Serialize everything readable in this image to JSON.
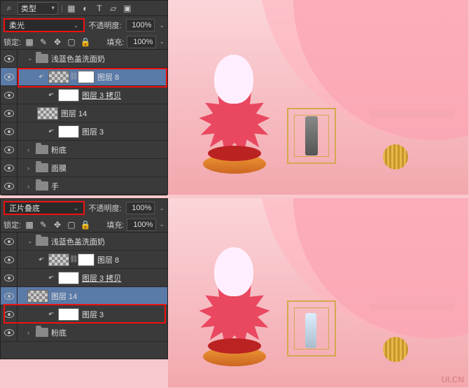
{
  "filter": {
    "label": "类型",
    "icons": [
      "image",
      "adjust",
      "text",
      "shape",
      "smart"
    ]
  },
  "top": {
    "blend": "柔光",
    "opacity_lbl": "不透明度:",
    "opacity": "100%",
    "lock_lbl": "锁定:",
    "fill_lbl": "填充:",
    "fill": "100%",
    "group": "浅蓝色盖洗面奶",
    "layers": [
      {
        "name": "图层 8",
        "thumb": "checker",
        "mask": true,
        "sel": true,
        "fx": true,
        "indent": 2
      },
      {
        "name": "图层 3 拷贝",
        "thumb": "white",
        "mask": false,
        "fx": true,
        "indent": 3,
        "underline": true
      },
      {
        "name": "图层 14",
        "thumb": "checker",
        "mask": false,
        "indent": 2
      },
      {
        "name": "图层 3",
        "thumb": "white",
        "mask": false,
        "fx": true,
        "indent": 3
      }
    ],
    "folders": [
      "粉底",
      "面膜",
      "手"
    ]
  },
  "bottom": {
    "blend": "正片叠底",
    "opacity_lbl": "不透明度:",
    "opacity": "100%",
    "lock_lbl": "锁定:",
    "fill_lbl": "填充:",
    "fill": "100%",
    "group": "浅蓝色盖洗面奶",
    "layers": [
      {
        "name": "图层 8",
        "thumb": "checker",
        "mask": true,
        "fx": true,
        "indent": 2
      },
      {
        "name": "图层 3 拷贝",
        "thumb": "white",
        "fx": true,
        "indent": 3,
        "underline": true
      },
      {
        "name": "图层 14",
        "thumb": "checker",
        "sel": true,
        "indent": 1
      },
      {
        "name": "图层 3",
        "thumb": "white",
        "fx": true,
        "indent": 3
      }
    ],
    "folders": [
      "粉底"
    ]
  },
  "watermark": "UI.CN"
}
